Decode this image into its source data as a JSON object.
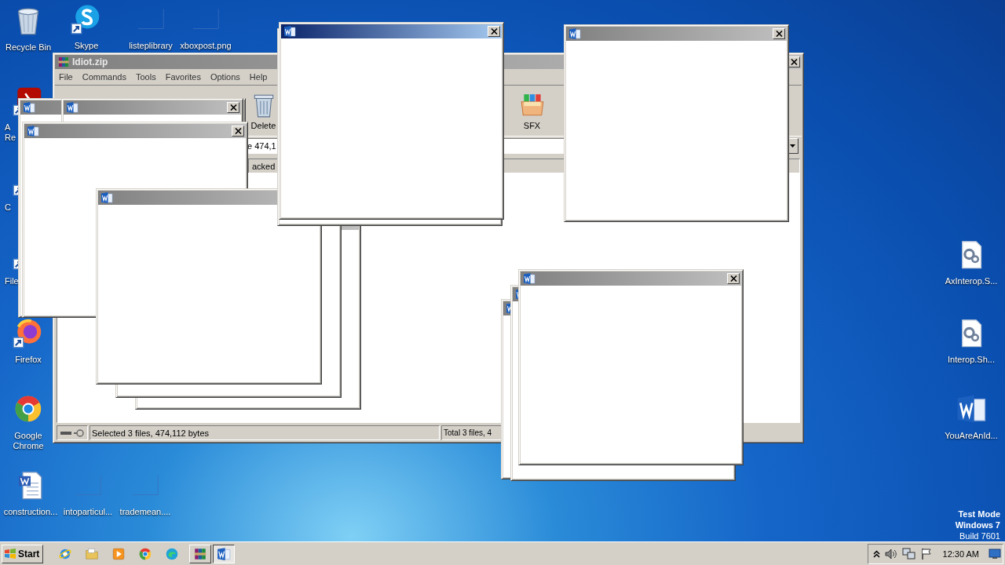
{
  "desktop_icons": [
    {
      "kind": "recycle",
      "lines": [
        "Recycle Bin"
      ]
    },
    {
      "kind": "skype",
      "lines": [
        "Skype"
      ]
    },
    {
      "kind": "blank",
      "lines": [
        "listeplibrary"
      ]
    },
    {
      "kind": "blank",
      "lines": [
        "xboxpost.png"
      ]
    },
    {
      "kind": "adobe",
      "lines": [
        "A",
        "Re"
      ]
    },
    {
      "kind": "shortcut",
      "lines": [
        "C"
      ]
    },
    {
      "kind": "redapp",
      "lines": [
        "File"
      ]
    },
    {
      "kind": "firefox",
      "lines": [
        "Firefox"
      ]
    },
    {
      "kind": "chrome",
      "lines": [
        "Google",
        "Chrome"
      ]
    },
    {
      "kind": "worddoc",
      "lines": [
        "construction..."
      ]
    },
    {
      "kind": "blank",
      "lines": [
        "intoparticul..."
      ]
    },
    {
      "kind": "blank",
      "lines": [
        "trademean...."
      ]
    },
    {
      "kind": "gears",
      "lines": [
        "AxInterop.S..."
      ]
    },
    {
      "kind": "gears",
      "lines": [
        "Interop.Sh..."
      ]
    },
    {
      "kind": "word",
      "lines": [
        "YouAreAnId..."
      ]
    }
  ],
  "archive_window": {
    "title": "Idiot.zip",
    "active": false,
    "menu": [
      "File",
      "Commands",
      "Tools",
      "Favorites",
      "Options",
      "Help"
    ],
    "toolbar": [
      {
        "kind": "delete",
        "label": "Delete"
      },
      {
        "kind": "sfx",
        "label": "SFX"
      }
    ],
    "path_field": "e 474,1",
    "column_1": "acked",
    "status": [
      "Selected 3 files, 474,112 bytes",
      "Total 3 files, 4"
    ]
  },
  "popups": [
    {
      "kind": "window",
      "active": false
    },
    {
      "kind": "window",
      "active": false
    },
    {
      "kind": "window",
      "active": false
    },
    {
      "kind": "window",
      "active": false
    },
    {
      "kind": "window"
    },
    {
      "kind": "window",
      "active": false
    },
    {
      "kind": "window"
    },
    {
      "kind": "window",
      "active": true
    },
    {
      "kind": "window",
      "active": false
    },
    {
      "kind": "window",
      "active": false
    },
    {
      "kind": "window",
      "active": false
    },
    {
      "kind": "window",
      "active": false
    }
  ],
  "system_text": [
    "Test Mode",
    "Windows 7",
    "Build 7601"
  ],
  "taskbar": {
    "start": "Start",
    "quick_launch": [
      {
        "kind": "ie"
      },
      {
        "kind": "folder"
      },
      {
        "kind": "media"
      },
      {
        "kind": "chrome"
      },
      {
        "kind": "edge"
      }
    ],
    "tasks": [
      {
        "kind": "winrar",
        "selected": false
      },
      {
        "kind": "word",
        "selected": true
      }
    ],
    "tray": {
      "time": "12:30 AM"
    }
  }
}
